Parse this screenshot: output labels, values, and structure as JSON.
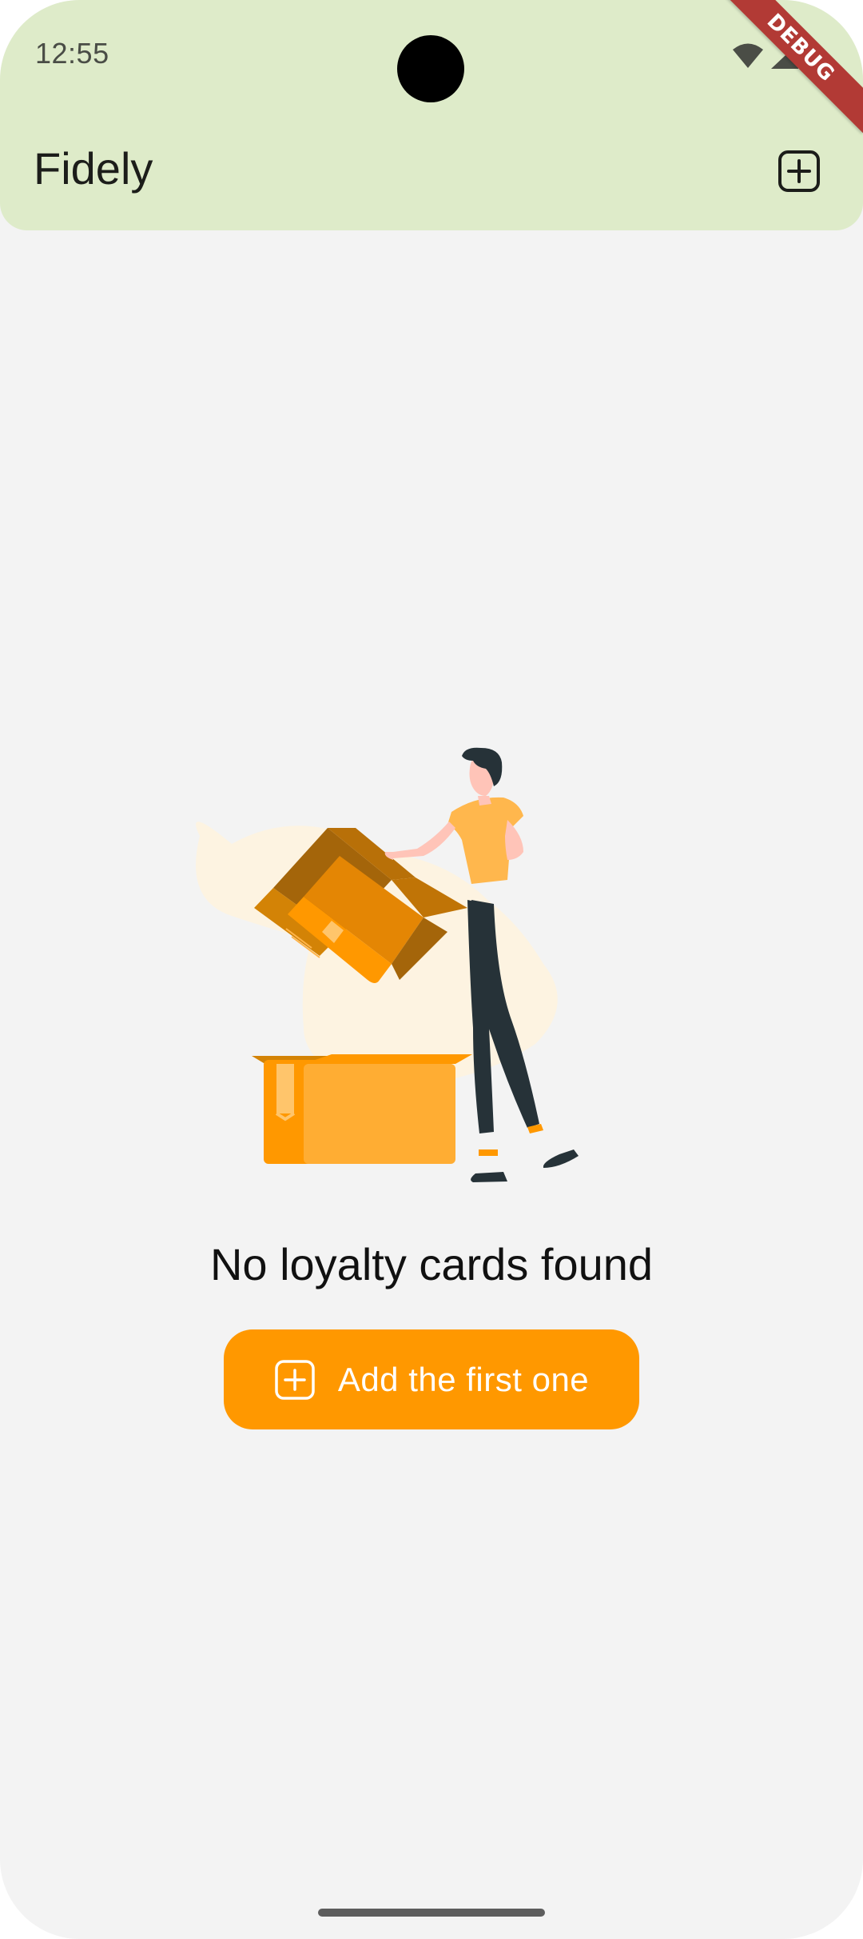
{
  "status_bar": {
    "time": "12:55",
    "icons": [
      "wifi-icon",
      "signal-icon",
      "battery-icon"
    ]
  },
  "debug_banner": {
    "label": "DEBUG"
  },
  "app_bar": {
    "title": "Fidely",
    "action_icon": "add-box-icon"
  },
  "empty_state": {
    "illustration": "person-unpacking-boxes",
    "message": "No loyalty cards found",
    "button_label": "Add the first one",
    "button_icon": "add-box-icon"
  },
  "colors": {
    "app_bar": "#deebc9",
    "background": "#f3f3f3",
    "accent": "#ff9800",
    "debug": "#b23a35"
  }
}
